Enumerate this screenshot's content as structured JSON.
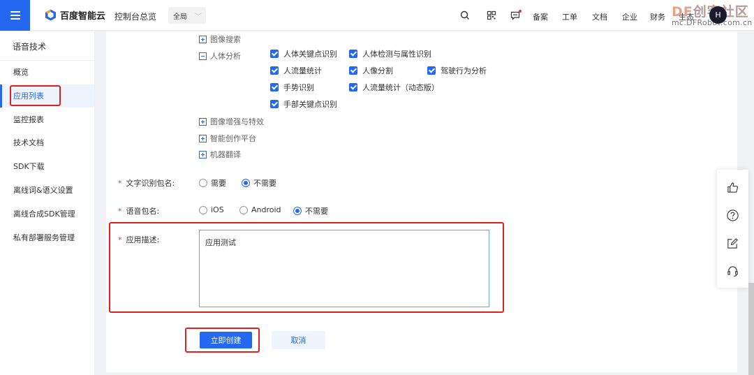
{
  "header": {
    "logo_text": "百度智能云",
    "console_link": "控制台总览",
    "region": "全局",
    "links": [
      "备案",
      "工单",
      "文档",
      "企业",
      "财务",
      "生态"
    ],
    "avatar_initial": "H",
    "watermark_top_de": "DF",
    "watermark_top_cn": "创客社区",
    "watermark_bottom": "mc.DFRobot.com.cn"
  },
  "sidebar": {
    "title": "语音技术",
    "items": [
      {
        "label": "概览"
      },
      {
        "label": "应用列表",
        "active": true
      },
      {
        "label": "监控报表"
      },
      {
        "label": "技术文档"
      },
      {
        "label": "SDK下载"
      },
      {
        "label": "离线词&语义设置"
      },
      {
        "label": "离线合成SDK管理"
      },
      {
        "label": "私有部署服务管理"
      }
    ]
  },
  "api_tree": {
    "image_search": "图像搜索",
    "body_analysis": "人体分析",
    "body_checks": [
      "人体关键点识别",
      "人体检测与属性识别",
      "人流量统计",
      "人像分割",
      "驾驶行为分析",
      "手势识别",
      "人流量统计（动态版）",
      "手部关键点识别"
    ],
    "image_enhance": "图像增强与特效",
    "smart_creation": "智能创作平台",
    "machine_translation": "机器翻译"
  },
  "form": {
    "ocr_pkg": {
      "label": "文字识别包名:",
      "options": [
        "需要",
        "不需要"
      ],
      "selected": "不需要"
    },
    "speech_pkg": {
      "label": "语音包名:",
      "options": [
        "iOS",
        "Android",
        "不需要"
      ],
      "selected": "不需要"
    },
    "description": {
      "label": "应用描述:",
      "value": "应用测试"
    },
    "required_mark": "*",
    "submit_label": "立即创建",
    "cancel_label": "取消"
  },
  "colors": {
    "primary": "#2468f2",
    "highlight": "#e02020"
  }
}
